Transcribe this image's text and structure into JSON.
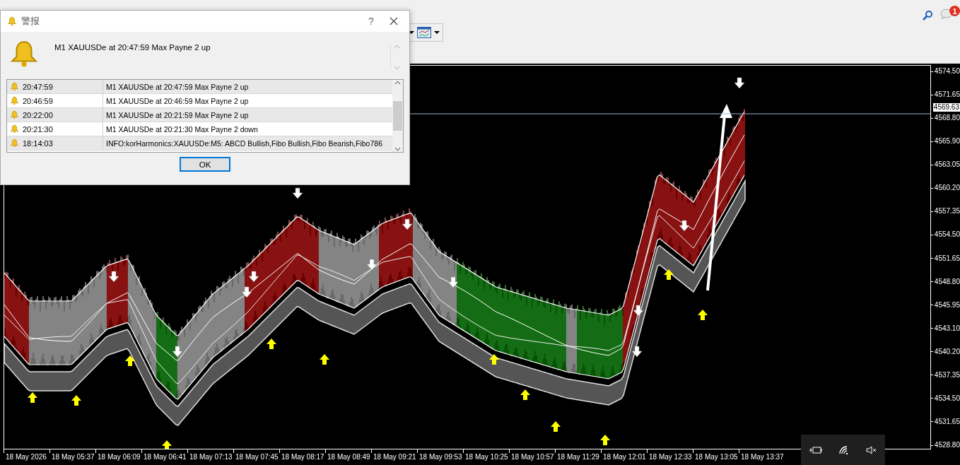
{
  "toolbar": {
    "notification_count": "1"
  },
  "alert_dialog": {
    "title": "警报",
    "help": "?",
    "message": "M1 XAUUSDe at 20:47:59 Max Payne 2 up",
    "alerts": [
      {
        "time": "20:47:59",
        "text": "M1 XAUUSDe at 20:47:59 Max Payne 2 up"
      },
      {
        "time": "20:46:59",
        "text": "M1 XAUUSDe at 20:46:59 Max Payne 2 up"
      },
      {
        "time": "20:22:00",
        "text": "M1 XAUUSDe at 20:21:59 Max Payne 2 up"
      },
      {
        "time": "20:21:30",
        "text": "M1 XAUUSDe at 20:21:30 Max Payne 2 down"
      },
      {
        "time": "18:14:03",
        "text": "INFO:korHarmonics:XAUUSDe:M5: ABCD Bullish,Fibo Bullish,Fibo Bearish,Fibo786"
      }
    ],
    "ok_button": "OK"
  },
  "chart": {
    "current_price": "4569.63",
    "price_labels": [
      "4574.50",
      "4571.65",
      "4568.80",
      "4565.90",
      "4563.05",
      "4560.20",
      "4557.35",
      "4554.50",
      "4551.65",
      "4548.80",
      "4545.95",
      "4543.10",
      "4540.20",
      "4537.35",
      "4534.50",
      "4531.65",
      "4528.80"
    ],
    "time_labels": [
      "18 May 2026",
      "18 May 05:37",
      "18 May 06:09",
      "18 May 06:41",
      "18 May 07:13",
      "18 May 07:45",
      "18 May 08:17",
      "18 May 08:49",
      "18 May 09:21",
      "18 May 09:53",
      "18 May 10:25",
      "18 May 10:57",
      "18 May 11:29",
      "18 May 12:01",
      "18 May 12:33",
      "18 May 13:05",
      "18 May 13:37"
    ]
  }
}
